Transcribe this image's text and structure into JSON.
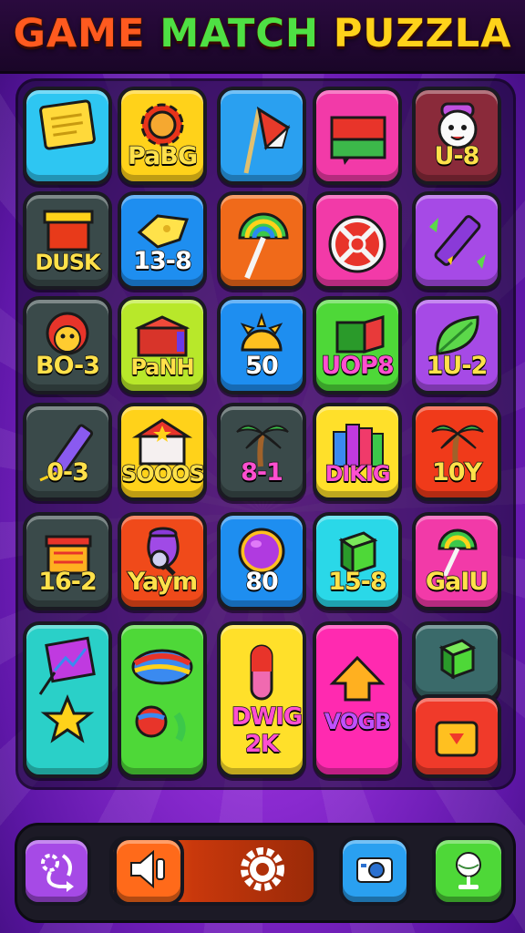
{
  "header": {
    "title_part1": "GAME",
    "title_part2": "MATCH",
    "title_part3": "PUZZLA"
  },
  "colors": {
    "background": "#8a2ad0",
    "title_orange": "#ff5a1f",
    "title_green": "#4ee044",
    "title_yellow": "#ffd21a"
  },
  "tiles": [
    {
      "label": "",
      "icon": "note-icon",
      "color": "#2ec6f2"
    },
    {
      "label": "PaBG",
      "icon": "gear-icon",
      "color": "#ffd21a"
    },
    {
      "label": "",
      "icon": "flag-icon",
      "color": "#2aa0f0"
    },
    {
      "label": "",
      "icon": "book-icon",
      "color": "#f23aa8"
    },
    {
      "label": "U-8",
      "icon": "ghost-face-icon",
      "color": "#8a2a3a"
    },
    {
      "label": "DUSK",
      "icon": "crate-icon",
      "color": "#3a4a4a"
    },
    {
      "label": "13-8",
      "icon": "cheese-icon",
      "color": "#1e8ef0"
    },
    {
      "label": "",
      "icon": "rainbow-umbrella-icon",
      "color": "#f06a1a"
    },
    {
      "label": "",
      "icon": "target-wheel-icon",
      "color": "#f23aa8"
    },
    {
      "label": "",
      "icon": "pencil-icon",
      "color": "#a64ae6"
    },
    {
      "label": "BO-3",
      "icon": "character-icon",
      "color": "#3a4a4a"
    },
    {
      "label": "PaNH",
      "icon": "chest-icon",
      "color": "#b8e82a"
    },
    {
      "label": "50",
      "icon": "sun-icon",
      "color": "#1e8ef0"
    },
    {
      "label": "UOP8",
      "icon": "green-box-icon",
      "color": "#4ed838"
    },
    {
      "label": "1U-2",
      "icon": "leaf-icon",
      "color": "#a64ae6"
    },
    {
      "label": "0-3",
      "icon": "marker-icon",
      "color": "#3a4a4a"
    },
    {
      "label": "SOOOS",
      "icon": "house-star-icon",
      "color": "#ffd21a"
    },
    {
      "label": "8-1",
      "icon": "palm-tree-icon",
      "color": "#3a4a4a"
    },
    {
      "label": "DIKIG",
      "icon": "books-icon",
      "color": "#ffe02a"
    },
    {
      "label": "10Y",
      "icon": "palm-tree-icon",
      "color": "#f03a1a"
    },
    {
      "label": "16-2",
      "icon": "gift-box-icon",
      "color": "#3a4a4a"
    },
    {
      "label": "Yaym",
      "icon": "magnifier-pot-icon",
      "color": "#f04a1a"
    },
    {
      "label": "80",
      "icon": "purple-ball-icon",
      "color": "#1e8ef0"
    },
    {
      "label": "15-8",
      "icon": "green-cube-icon",
      "color": "#2ad8e8"
    },
    {
      "label": "GaIU",
      "icon": "rainbow-umbrella-icon",
      "color": "#f23aa8"
    },
    {
      "label": "",
      "icon": "chart-star-icon",
      "color": "#2ad0c8"
    },
    {
      "label": "",
      "icon": "candy-icon",
      "color": "#4ed838"
    },
    {
      "label": "DWIG 2K",
      "icon": "capsule-icon",
      "color": "#ffe02a"
    },
    {
      "label": "VOGB",
      "icon": "arrow-up-icon",
      "color": "#ff2ab0"
    },
    {
      "label": "",
      "icon": "green-cube-icon",
      "color": "#3a6a6a"
    },
    {
      "label": "",
      "icon": "folder-down-icon",
      "color": "#f03a2a"
    }
  ],
  "bottom_bar": {
    "buttons": [
      {
        "name": "shuffle",
        "icon": "shuffle-gear-icon",
        "color": "#a64ae6"
      },
      {
        "name": "sound",
        "icon": "speaker-icon",
        "color": "#ff6a1a"
      },
      {
        "name": "settings",
        "icon": "gear-icon",
        "color": "#c9380c"
      },
      {
        "name": "camera",
        "icon": "camera-icon",
        "color": "#2aa0f0"
      },
      {
        "name": "globe",
        "icon": "globe-icon",
        "color": "#4ed838"
      }
    ]
  }
}
